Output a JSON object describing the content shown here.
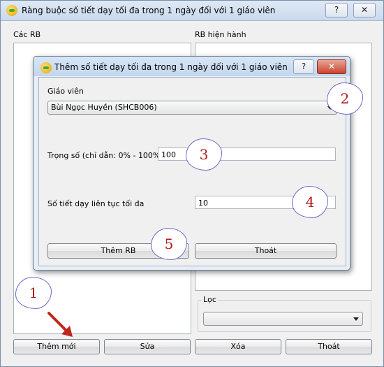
{
  "main_window": {
    "title": "Ràng buộc số tiết dạy tối đa trong 1 ngày đối với 1 giáo viên",
    "help_label": "?",
    "close_label": "✕",
    "left_list_label": "Các RB",
    "right_list_label": "RB hiện hành",
    "filter_label": "Lọc",
    "filter_value": "",
    "buttons": {
      "add": "Thêm mới",
      "edit": "Sửa",
      "delete": "Xóa",
      "exit": "Thoát"
    }
  },
  "dialog": {
    "title": "Thêm số tiết dạy tối đa trong 1 ngày đối với 1 giáo viên",
    "help_label": "?",
    "close_label": "✕",
    "teacher_label": "Giáo viên",
    "teacher_value": "Bùi Ngọc Huyền (SHCB006)",
    "weight_label": "Trọng số (chỉ dẫn: 0% - 100%)",
    "weight_value": "100",
    "consecutive_label": "Số tiết dạy liên tục tối đa",
    "consecutive_value": "10",
    "buttons": {
      "add": "Thêm RB",
      "exit": "Thoát"
    }
  },
  "annotations": [
    "1",
    "2",
    "3",
    "4",
    "5"
  ],
  "colors": {
    "annotation_text": "#b21a1a",
    "annotation_border": "#6a6ac8",
    "arrow": "#c0261b"
  }
}
